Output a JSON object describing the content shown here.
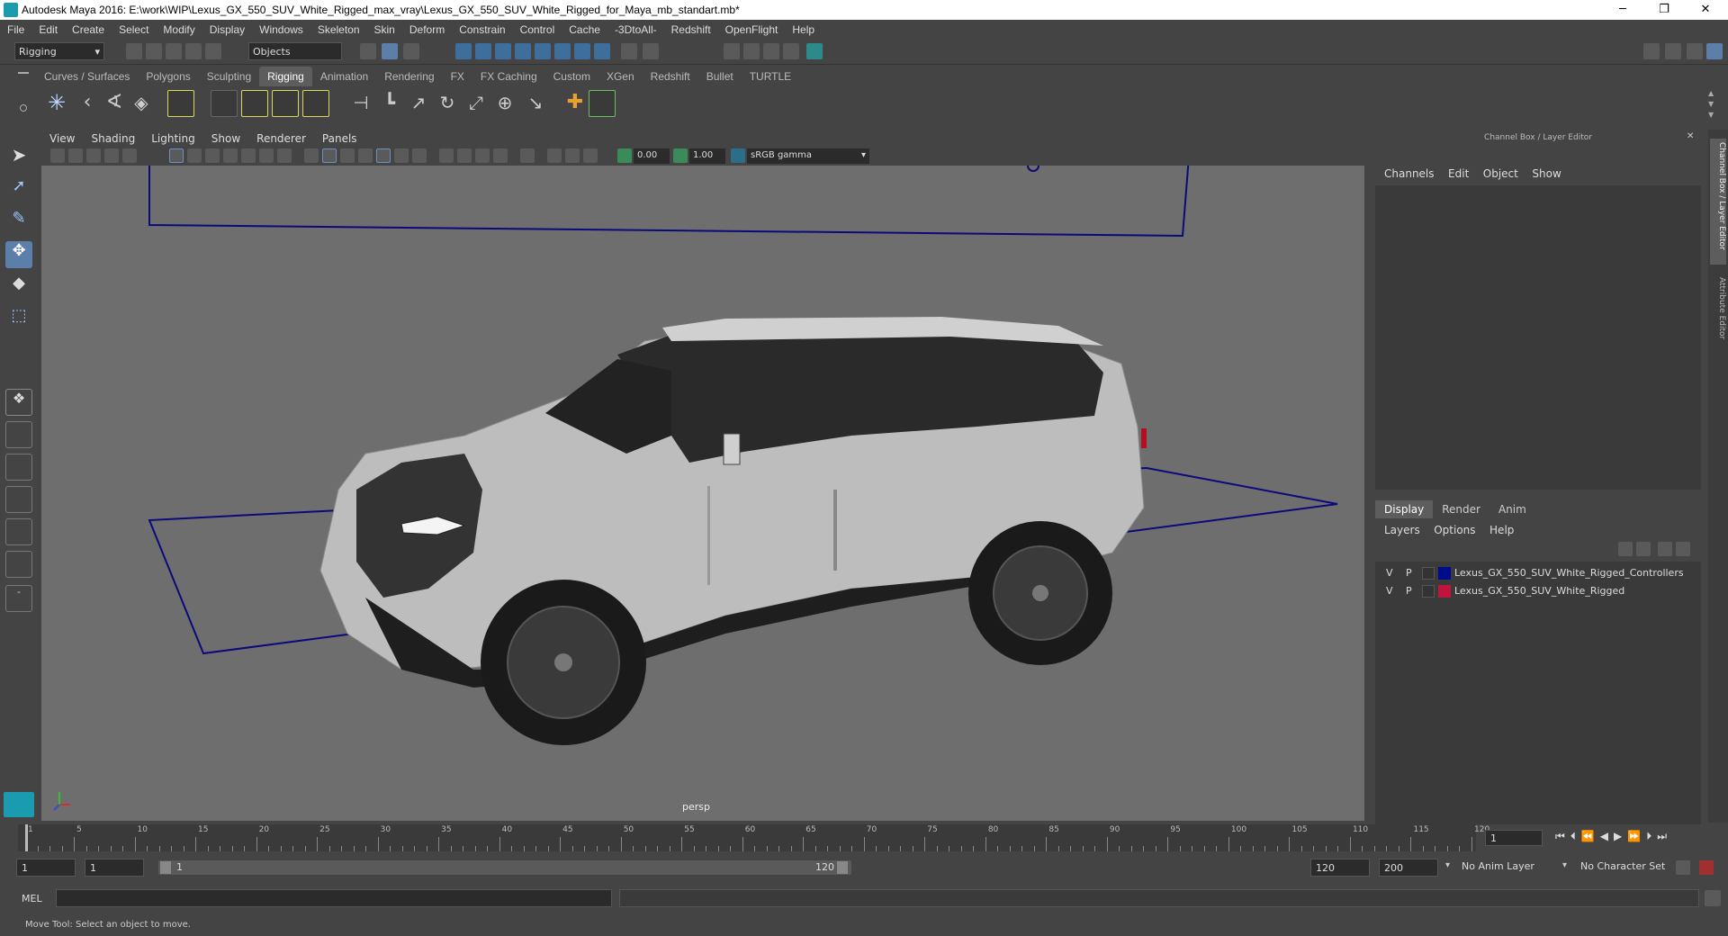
{
  "window": {
    "title": "Autodesk Maya 2016: E:\\work\\WIP\\Lexus_GX_550_SUV_White_Rigged_max_vray\\Lexus_GX_550_SUV_White_Rigged_for_Maya_mb_standart.mb*",
    "minimize": "─",
    "restore": "❐",
    "close": "✕"
  },
  "menubar": [
    "File",
    "Edit",
    "Create",
    "Select",
    "Modify",
    "Display",
    "Windows",
    "Skeleton",
    "Skin",
    "Deform",
    "Constrain",
    "Control",
    "Cache",
    "-3DtoAll-",
    "Redshift",
    "OpenFlight",
    "Help"
  ],
  "statusline": {
    "menuset": "Rigging",
    "selection_mode": "Objects"
  },
  "shelf_tabs": [
    "Curves / Surfaces",
    "Polygons",
    "Sculpting",
    "Rigging",
    "Animation",
    "Rendering",
    "FX",
    "FX Caching",
    "Custom",
    "XGen",
    "Redshift",
    "Bullet",
    "TURTLE"
  ],
  "active_shelf_tab": "Rigging",
  "viewport": {
    "menu": [
      "View",
      "Shading",
      "Lighting",
      "Show",
      "Renderer",
      "Panels"
    ],
    "exposure": "0.00",
    "gamma": "1.00",
    "colorspace": "sRGB gamma",
    "camera_label": "persp"
  },
  "channelbox": {
    "title": "Channel Box / Layer Editor",
    "menu": [
      "Channels",
      "Edit",
      "Object",
      "Show"
    ],
    "layer_tabs": [
      "Display",
      "Render",
      "Anim"
    ],
    "active_layer_tab": "Display",
    "layer_menu": [
      "Layers",
      "Options",
      "Help"
    ],
    "layers": [
      {
        "v": "V",
        "p": "P",
        "color": "#000a8c",
        "name": "Lexus_GX_550_SUV_White_Rigged_Controllers"
      },
      {
        "v": "V",
        "p": "P",
        "color": "#c0143c",
        "name": "Lexus_GX_550_SUV_White_Rigged"
      }
    ]
  },
  "side_tabs": {
    "channel": "Channel Box / Layer Editor",
    "attribute": "Attribute Editor"
  },
  "timeline": {
    "ticks": [
      "1",
      "5",
      "10",
      "15",
      "20",
      "25",
      "30",
      "35",
      "40",
      "45",
      "50",
      "55",
      "60",
      "65",
      "70",
      "75",
      "80",
      "85",
      "90",
      "95",
      "100",
      "105",
      "110",
      "115",
      "120"
    ],
    "current_frame": "1"
  },
  "range": {
    "start": "1",
    "playback_start": "1",
    "slider_start": "1",
    "slider_end": "120",
    "playback_end": "120",
    "end": "200",
    "anim_layer": "No Anim Layer",
    "character_set": "No Character Set"
  },
  "mel": {
    "label": "MEL"
  },
  "helpline": "Move Tool: Select an object to move."
}
